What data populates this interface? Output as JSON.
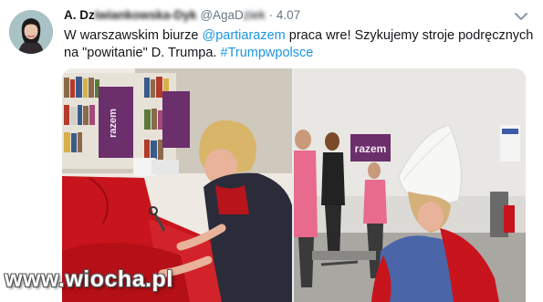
{
  "tweet": {
    "author_name_visible": "A. Dz",
    "author_name_blurred": "iwiankowska-Dyk",
    "handle_visible": "@AgaD",
    "handle_blurred": "ziek",
    "separator": "·",
    "date": "4.07",
    "text_part1": "W warszawskim biurze ",
    "mention": "@partiarazem",
    "text_part2": " praca wre! Szykujemy stroje podręcznych na \"powitanie\" D. Trumpa. ",
    "hashtag": "#Trumpwpolsce"
  },
  "media": {
    "left_photo_banner": "razem",
    "right_photo_banner": "razem"
  },
  "watermark": {
    "text": "www.wiocha.pl"
  },
  "colors": {
    "link": "#1b95e0",
    "text": "#14171a",
    "secondary": "#657786",
    "party_purple": "#6b2f6b",
    "cloth_red": "#c8141c"
  },
  "icons": [
    "avatar",
    "chevron-down-icon"
  ]
}
